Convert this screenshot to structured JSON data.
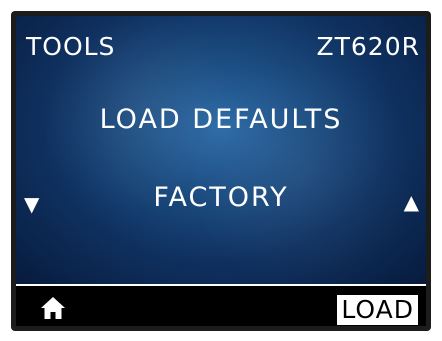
{
  "header": {
    "section": "TOOLS",
    "model": "ZT620R"
  },
  "menu": {
    "title": "LOAD DEFAULTS",
    "value": "FACTORY",
    "prev_icon": "triangle-down-icon",
    "next_icon": "triangle-up-icon",
    "prev_glyph": "▼",
    "next_glyph": "▲"
  },
  "footer": {
    "home_icon": "home-icon",
    "action_label": "LOAD"
  },
  "colors": {
    "screen_center": "#2c6aa6",
    "screen_edge": "#071b3d",
    "text": "#ffffff",
    "footer_bg": "#000000"
  }
}
